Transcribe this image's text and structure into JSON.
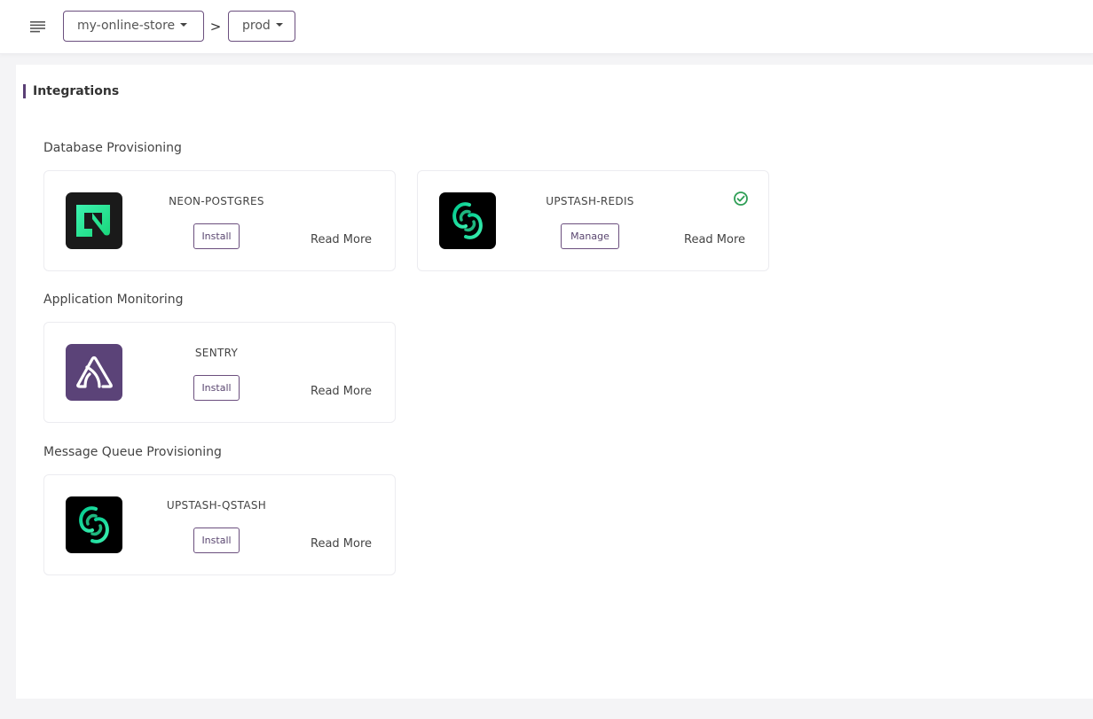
{
  "header": {
    "menu_icon": "hamburger-menu-icon",
    "project_selector": "my-online-store",
    "breadcrumb_separator": ">",
    "environment_selector": "prod"
  },
  "page": {
    "title": "Integrations",
    "accent_color": "#5a3f75"
  },
  "sections": [
    {
      "title": "Database Provisioning",
      "cards": [
        {
          "name": "NEON-POSTGRES",
          "logo": "neon-logo",
          "action": "Install",
          "read_more": "Read More",
          "installed": false
        },
        {
          "name": "UPSTASH-REDIS",
          "logo": "upstash-logo",
          "action": "Manage",
          "read_more": "Read More",
          "installed": true,
          "status_icon": "check-circle-icon",
          "status_color": "#2e9e55"
        }
      ]
    },
    {
      "title": "Application Monitoring",
      "cards": [
        {
          "name": "SENTRY",
          "logo": "sentry-logo",
          "action": "Install",
          "read_more": "Read More",
          "installed": false
        }
      ]
    },
    {
      "title": "Message Queue Provisioning",
      "cards": [
        {
          "name": "UPSTASH-QSTASH",
          "logo": "upstash-logo",
          "action": "Install",
          "read_more": "Read More",
          "installed": false
        }
      ]
    }
  ]
}
